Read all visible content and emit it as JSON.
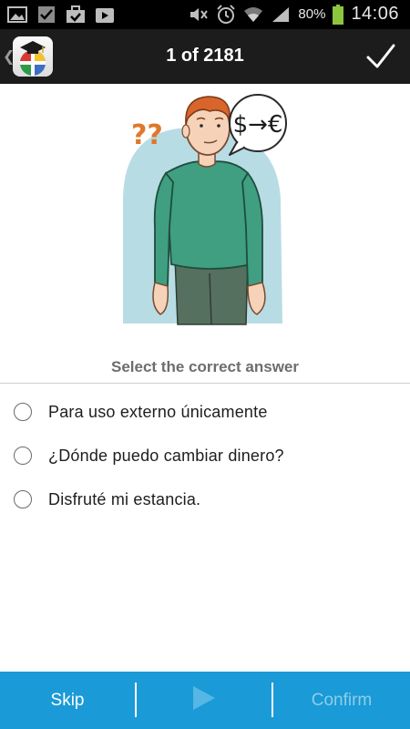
{
  "status_bar": {
    "battery_percent": "80%",
    "time": "14:06",
    "icons": [
      "gallery-icon",
      "checkbox-icon",
      "briefcase-check-icon",
      "play-store-icon",
      "mute-icon",
      "alarm-icon",
      "wifi-icon",
      "signal-icon",
      "battery-icon"
    ]
  },
  "action_bar": {
    "counter": "1 of 2181",
    "back_icon": "chevron-left-icon",
    "app_icon": "language-flags-graduation-icon",
    "check_icon": "checkmark-icon"
  },
  "illustration": {
    "question_marks": "??",
    "currency_text": "$→€"
  },
  "quiz": {
    "prompt": "Select the correct answer",
    "options": [
      {
        "label": "Para uso externo únicamente",
        "selected": false
      },
      {
        "label": "¿Dónde puedo cambiar dinero?",
        "selected": false
      },
      {
        "label": "Disfruté mi estancia.",
        "selected": false
      }
    ]
  },
  "bottom_bar": {
    "skip_label": "Skip",
    "play_icon": "play-icon",
    "confirm_label": "Confirm"
  },
  "colors": {
    "accent": "#1a9ad6",
    "confirm_disabled": "#8fcdea",
    "action_bar": "#1c1c1c"
  }
}
